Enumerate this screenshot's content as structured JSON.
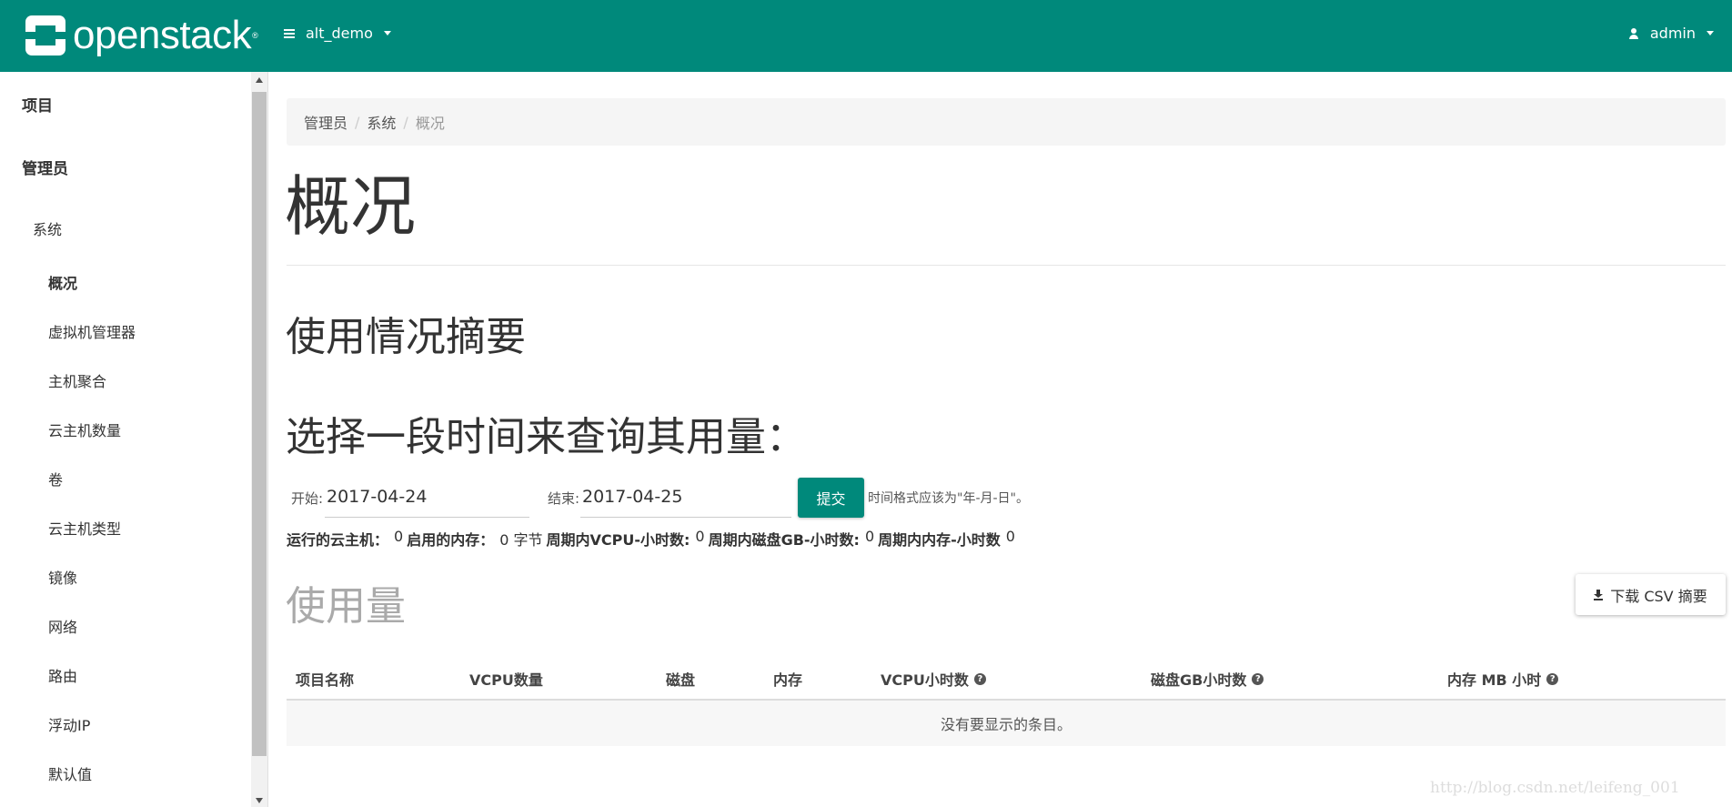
{
  "brand": {
    "name": "openstack",
    "registered": "®"
  },
  "topbar": {
    "project": "alt_demo",
    "user": "admin"
  },
  "sidebar": {
    "project": "项目",
    "admin": "管理员",
    "system": "系统",
    "items": [
      "概况",
      "虚拟机管理器",
      "主机聚合",
      "云主机数量",
      "卷",
      "云主机类型",
      "镜像",
      "网络",
      "路由",
      "浮动IP",
      "默认值"
    ]
  },
  "breadcrumb": [
    "管理员",
    "系统",
    "概况"
  ],
  "page_title": "概况",
  "summary_heading": "使用情况摘要",
  "select_heading": "选择一段时间来查询其用量：",
  "form": {
    "start_label": "开始:",
    "start_value": "2017-04-24",
    "end_label": "结束:",
    "end_value": "2017-04-25",
    "submit": "提交",
    "hint": "时间格式应该为\"年-月-日\"。"
  },
  "stats": [
    {
      "label": "运行的云主机：",
      "value": "0"
    },
    {
      "label": "启用的内存：",
      "value": "0 字节"
    },
    {
      "label": "周期内VCPU-小时数:",
      "value": "0"
    },
    {
      "label": "周期内磁盘GB-小时数:",
      "value": "0"
    },
    {
      "label": "周期内内存-小时数",
      "value": "0"
    }
  ],
  "usage_heading": "使用量",
  "csv_button": "下载 CSV 摘要",
  "table": {
    "columns": [
      "项目名称",
      "VCPU数量",
      "磁盘",
      "内存",
      "VCPU小时数",
      "磁盘GB小时数",
      "内存 MB 小时"
    ],
    "empty": "没有要显示的条目。"
  },
  "watermark": "http://blog.csdn.net/leifeng_001",
  "colors": {
    "primary": "#00897b"
  }
}
